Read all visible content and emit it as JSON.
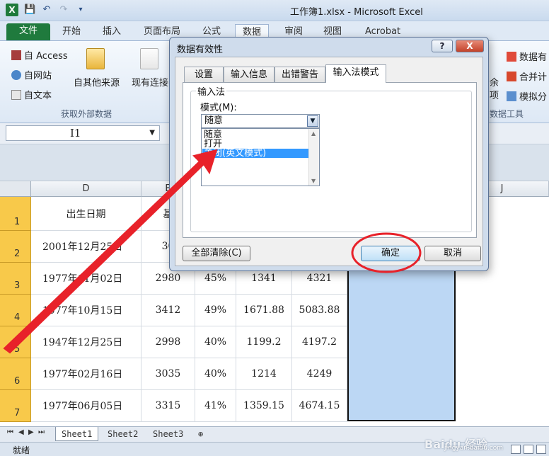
{
  "window": {
    "title": "工作簿1.xlsx - Microsoft Excel"
  },
  "ribbon_tabs": [
    "文件",
    "开始",
    "插入",
    "页面布局",
    "公式",
    "数据",
    "审阅",
    "视图",
    "Acrobat"
  ],
  "ribbon": {
    "from_access": "自 Access",
    "from_web": "自网站",
    "from_text": "自文本",
    "other_sources": "自其他来源",
    "existing": "现有连接",
    "group_external": "获取外部数据",
    "right_items": [
      "数据有",
      "合并计",
      "模拟分"
    ],
    "right_partial": "项",
    "right_partial_2": "余",
    "group_tools": "数据工具"
  },
  "name_box": {
    "value": "I1"
  },
  "columns": {
    "d": "D",
    "e": "E",
    "j": "J"
  },
  "rows": [
    "1",
    "2",
    "3",
    "4",
    "5",
    "6",
    "7"
  ],
  "table": {
    "header": {
      "birth": "出生日期",
      "base": "基"
    },
    "rows": [
      {
        "date": "2001年12月25日",
        "base": "30",
        "pct": "",
        "v1": "",
        "v2": ""
      },
      {
        "date": "1977年11月02日",
        "base": "2980",
        "pct": "45%",
        "v1": "1341",
        "v2": "4321"
      },
      {
        "date": "1977年10月15日",
        "base": "3412",
        "pct": "49%",
        "v1": "1671.88",
        "v2": "5083.88"
      },
      {
        "date": "1947年12月25日",
        "base": "2998",
        "pct": "40%",
        "v1": "1199.2",
        "v2": "4197.2"
      },
      {
        "date": "1977年02月16日",
        "base": "3035",
        "pct": "40%",
        "v1": "1214",
        "v2": "4249"
      },
      {
        "date": "1977年06月05日",
        "base": "3315",
        "pct": "41%",
        "v1": "1359.15",
        "v2": "4674.15"
      }
    ]
  },
  "sheets": [
    "Sheet1",
    "Sheet2",
    "Sheet3"
  ],
  "status": {
    "text": "就绪"
  },
  "dialog": {
    "title": "数据有效性",
    "help": "?",
    "close": "X",
    "tabs": [
      "设置",
      "输入信息",
      "出错警告",
      "输入法模式"
    ],
    "group_label": "输入法",
    "mode_label": "模式(M):",
    "mode_value": "随意",
    "options": [
      "随意",
      "打开",
      "关闭(英文模式)"
    ],
    "selected_option_index": 2,
    "clear_all": "全部清除(C)",
    "ok": "确定",
    "cancel": "取消"
  },
  "watermark": {
    "text": "Baidu 经验",
    "sub": "jingyan.baidu.com"
  },
  "colors": {
    "annotation": "#e8222a",
    "selection": "#bcd7f4",
    "row_header": "#f8c94a",
    "excel_green": "#1f7a3d"
  }
}
